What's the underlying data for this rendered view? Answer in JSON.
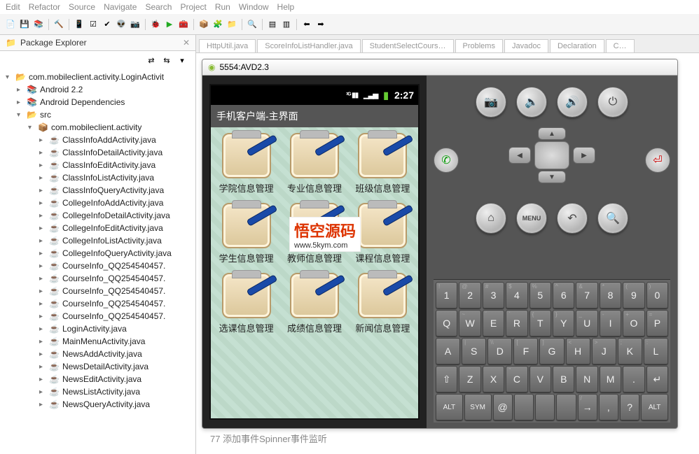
{
  "menubar": [
    "Edit",
    "Refactor",
    "Source",
    "Navigate",
    "Search",
    "Project",
    "Run",
    "Window",
    "Help"
  ],
  "explorer": {
    "title": "Package Explorer",
    "root": "com.mobileclient.activity.LoginActivit",
    "android_label": "Android 2.2",
    "deps_label": "Android Dependencies",
    "src_label": "src",
    "pkg_label": "com.mobileclient.activity",
    "files": [
      "ClassInfoAddActivity.java",
      "ClassInfoDetailActivity.java",
      "ClassInfoEditActivity.java",
      "ClassInfoListActivity.java",
      "ClassInfoQueryActivity.java",
      "CollegeInfoAddActivity.java",
      "CollegeInfoDetailActivity.java",
      "CollegeInfoEditActivity.java",
      "CollegeInfoListActivity.java",
      "CollegeInfoQueryActivity.java",
      "CourseInfo_QQ254540457.",
      "CourseInfo_QQ254540457.",
      "CourseInfo_QQ254540457.",
      "CourseInfo_QQ254540457.",
      "CourseInfo_QQ254540457.",
      "LoginActivity.java",
      "MainMenuActivity.java",
      "NewsAddActivity.java",
      "NewsDetailActivity.java",
      "NewsEditActivity.java",
      "NewsListActivity.java",
      "NewsQueryActivity.java"
    ]
  },
  "tabs": [
    "HttpUtil.java",
    "ScoreInfoListHandler.java",
    "StudentSelectCours…",
    "Problems",
    "Javadoc",
    "Declaration",
    "C…"
  ],
  "emu": {
    "title": "5554:AVD2.3",
    "clock": "2:27",
    "app_title": "手机客户端-主界面",
    "cells": [
      "学院信息管理",
      "专业信息管理",
      "班级信息管理",
      "学生信息管理",
      "教师信息管理",
      "课程信息管理",
      "选课信息管理",
      "成绩信息管理",
      "新闻信息管理"
    ],
    "watermark_title": "悟空源码",
    "watermark_url": "www.5kym.com"
  },
  "ctrl_labels": {
    "camera": "📷",
    "vol_down": "🔈",
    "vol_up": "🔊",
    "power": "⏻",
    "home": "⌂",
    "menu": "MENU",
    "back": "↶",
    "search": "🔍",
    "call": "✆",
    "end": "⏎"
  },
  "keyboard": {
    "row1": [
      {
        "m": "1",
        "s": "!"
      },
      {
        "m": "2",
        "s": "@"
      },
      {
        "m": "3",
        "s": "#"
      },
      {
        "m": "4",
        "s": "$"
      },
      {
        "m": "5",
        "s": "%"
      },
      {
        "m": "6",
        "s": "^"
      },
      {
        "m": "7",
        "s": "&"
      },
      {
        "m": "8",
        "s": "*"
      },
      {
        "m": "9",
        "s": "("
      },
      {
        "m": "0",
        "s": ")"
      }
    ],
    "row2": [
      {
        "m": "Q"
      },
      {
        "m": "W",
        "s": "~"
      },
      {
        "m": "E",
        "s": "´"
      },
      {
        "m": "R",
        "s": "`"
      },
      {
        "m": "T",
        "s": "{"
      },
      {
        "m": "Y",
        "s": "}"
      },
      {
        "m": "U",
        "s": "_"
      },
      {
        "m": "I",
        "s": "-"
      },
      {
        "m": "O",
        "s": "+"
      },
      {
        "m": "P",
        "s": "="
      }
    ],
    "row3": [
      {
        "m": "A"
      },
      {
        "m": "S",
        "s": "|"
      },
      {
        "m": "D",
        "s": "\\\\"
      },
      {
        "m": "F",
        "s": "["
      },
      {
        "m": "G",
        "s": "]"
      },
      {
        "m": "H",
        "s": "<"
      },
      {
        "m": "J",
        "s": ">"
      },
      {
        "m": "K",
        "s": ";"
      },
      {
        "m": "L",
        "s": ":"
      }
    ],
    "row4": [
      {
        "m": "⇧"
      },
      {
        "m": "Z"
      },
      {
        "m": "X"
      },
      {
        "m": "C",
        "s": "''"
      },
      {
        "m": "V"
      },
      {
        "m": "B"
      },
      {
        "m": "N"
      },
      {
        "m": "M"
      },
      {
        "m": "."
      },
      {
        "m": "↵"
      }
    ],
    "row5": [
      {
        "m": "ALT",
        "w": true
      },
      {
        "m": "SYM",
        "w": true
      },
      {
        "m": "@"
      },
      {
        "m": ""
      },
      {
        "m": ""
      },
      {
        "m": ""
      },
      {
        "m": "→",
        "s": "/"
      },
      {
        "m": ","
      },
      {
        "m": "?"
      },
      {
        "m": "ALT",
        "w": true
      }
    ]
  },
  "bottom_code": "77 添加事件Spinner事件监听"
}
